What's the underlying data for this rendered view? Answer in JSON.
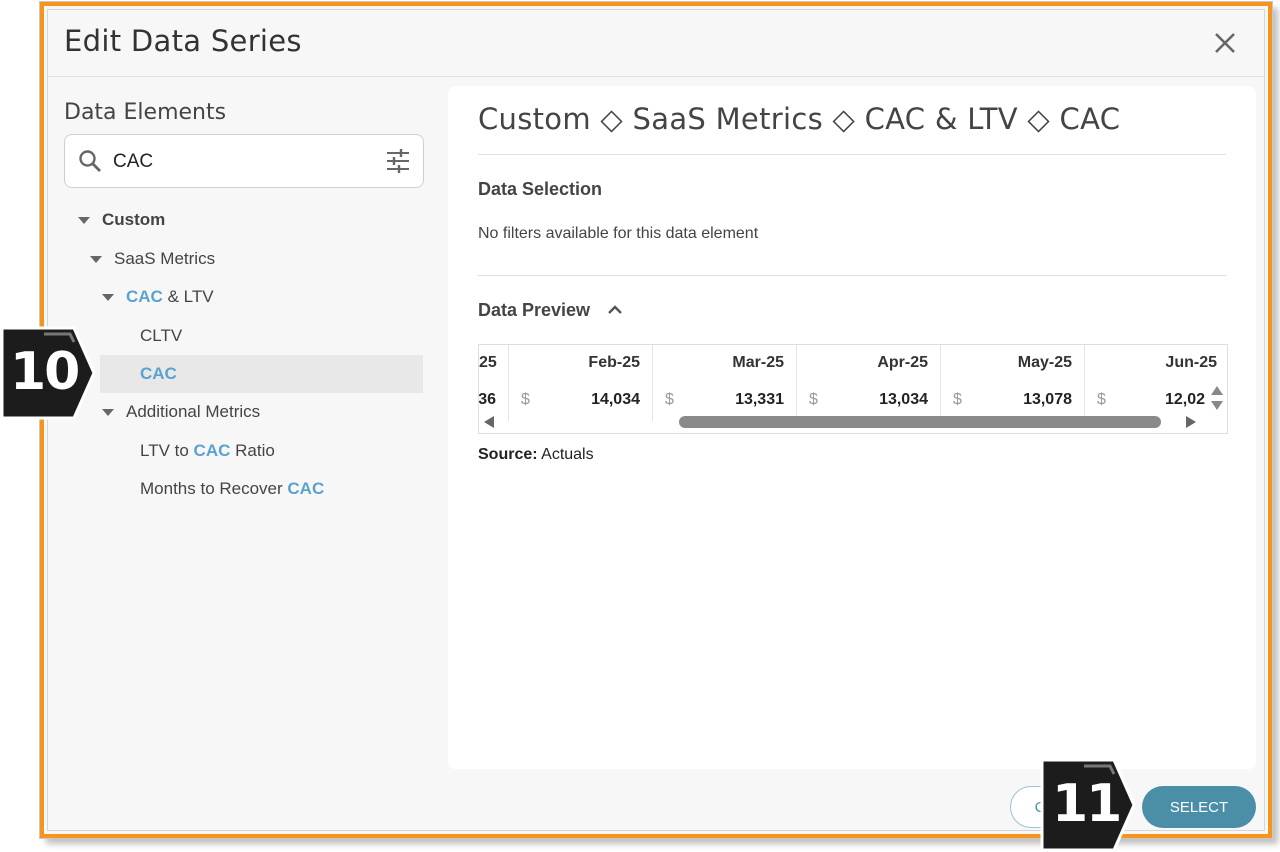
{
  "dialog": {
    "title": "Edit Data Series",
    "close_label": "×"
  },
  "left": {
    "heading": "Data Elements",
    "search": {
      "value": "CAC",
      "placeholder": ""
    },
    "tree": {
      "custom": "Custom",
      "saas": "SaaS Metrics",
      "cac_ltv_hl": "CAC",
      "cac_ltv_rest": " & LTV",
      "cltv": "CLTV",
      "cac": "CAC",
      "additional": "Additional Metrics",
      "ltv_ratio_pre": "LTV to ",
      "ltv_ratio_hl": "CAC",
      "ltv_ratio_post": " Ratio",
      "months_pre": "Months to Recover ",
      "months_hl": "CAC"
    }
  },
  "right": {
    "breadcrumb": "Custom ◇ SaaS Metrics ◇ CAC & LTV ◇ CAC",
    "data_selection_title": "Data Selection",
    "no_filters": "No filters available for this data element",
    "data_preview_title": "Data Preview",
    "preview": {
      "columns": [
        "25",
        "Feb-25",
        "Mar-25",
        "Apr-25",
        "May-25",
        "Jun-25"
      ],
      "currency_symbol": "$",
      "values": [
        "36",
        "14,034",
        "13,331",
        "13,034",
        "13,078",
        "12,02"
      ]
    },
    "source_label": "Source:",
    "source_value": " Actuals"
  },
  "footer": {
    "cancel_label": "CANCEL",
    "select_label": "SELECT"
  },
  "badges": {
    "step10": "10",
    "step11": "11"
  },
  "colors": {
    "accent": "#4a8ea7",
    "highlight": "#5aa3cf",
    "frame": "#f7941d"
  }
}
